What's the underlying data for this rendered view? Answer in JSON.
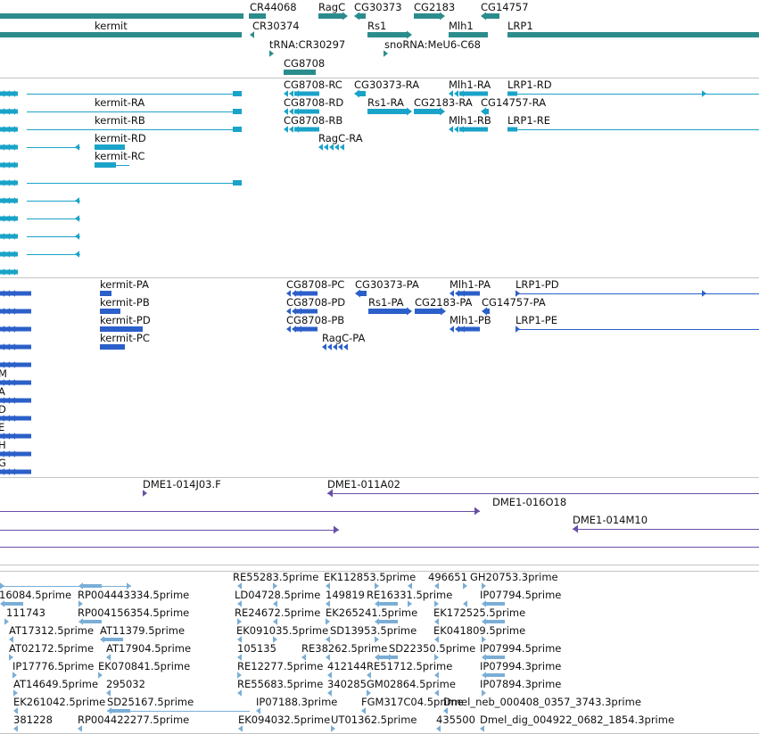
{
  "colors": {
    "gene": "#2b8c8c",
    "transcript": "#1aa3c8",
    "protein": "#2b5fc9",
    "clone": "#6a4fa8",
    "est": "#7aaed6",
    "separator": "#c4c4c4",
    "text": "#111111"
  },
  "tracks": {
    "genes": {
      "labels": [
        "CR44068",
        "RagC",
        "CG30373",
        "CG2183",
        "CG14757",
        "kermit",
        "CR30374",
        "Rs1",
        "Mlh1",
        "LRP1",
        "tRNA:CR30297",
        "snoRNA:MeU6-C68",
        "CG8708"
      ]
    },
    "transcripts": {
      "labels": [
        "CG8708-RC",
        "CG30373-RA",
        "Mlh1-RA",
        "LRP1-RD",
        "kermit-RA",
        "CG8708-RD",
        "Rs1-RA",
        "CG2183-RA",
        "CG14757-RA",
        "kermit-RB",
        "CG8708-RB",
        "Mlh1-RB",
        "LRP1-RE",
        "kermit-RD",
        "RagC-RA",
        "kermit-RC"
      ]
    },
    "proteins": {
      "labels": [
        "kermit-PA",
        "CG8708-PC",
        "CG30373-PA",
        "Mlh1-PA",
        "LRP1-PD",
        "kermit-PB",
        "CG8708-PD",
        "Rs1-PA",
        "CG2183-PA",
        "CG14757-PA",
        "kermit-PD",
        "CG8708-PB",
        "Mlh1-PB",
        "LRP1-PE",
        "kermit-PC",
        "RagC-PA"
      ],
      "edge_letters": [
        "M",
        "A",
        "D",
        "E",
        "H",
        "G"
      ]
    },
    "clones": {
      "labels": [
        "DME1-014J03.F",
        "DME1-011A02",
        "DME1-016O18",
        "DME1-014M10"
      ]
    },
    "ests": {
      "labels": [
        "RE55283.5prime",
        "EK112853.5prime",
        "496651",
        "GH20753.3prime",
        "16084.5prime",
        "RP004443334.5prime",
        "LD04728.5prime",
        "149819",
        "RE16331.5prime",
        "IP07794.5prime",
        "111743",
        "RP004156354.5prime",
        "RE24672.5prime",
        "EK265241.5prime",
        "EK172525.5prime",
        "AT17312.5prime",
        "AT11379.5prime",
        "EK091035.5prime",
        "SD13953.5prime",
        "EK041809.5prime",
        "AT02172.5prime",
        "AT17904.5prime",
        "105135",
        "RE38262.5prime",
        "SD22350.5prime",
        "IP07994.5prime",
        "IP17776.5prime",
        "EK070841.5prime",
        "RE12277.5prime",
        "412144",
        "RE51712.5prime",
        "IP07994.3prime",
        "AT14649.5prime",
        "295032",
        "RE55683.5prime",
        "340285",
        "GM02864.5prime",
        "IP07894.3prime",
        "EK261042.5prime",
        "SD25167.5prime",
        "IP07188.3prime",
        "FGM317C04.5prime",
        "Dmel_neb_000408_0357_3743.3prime",
        "381228",
        "RP004422277.5prime",
        "EK094032.5prime",
        "UT01362.5prime",
        "435500",
        "Dmel_dig_004922_0682_1854.3prime"
      ]
    }
  }
}
